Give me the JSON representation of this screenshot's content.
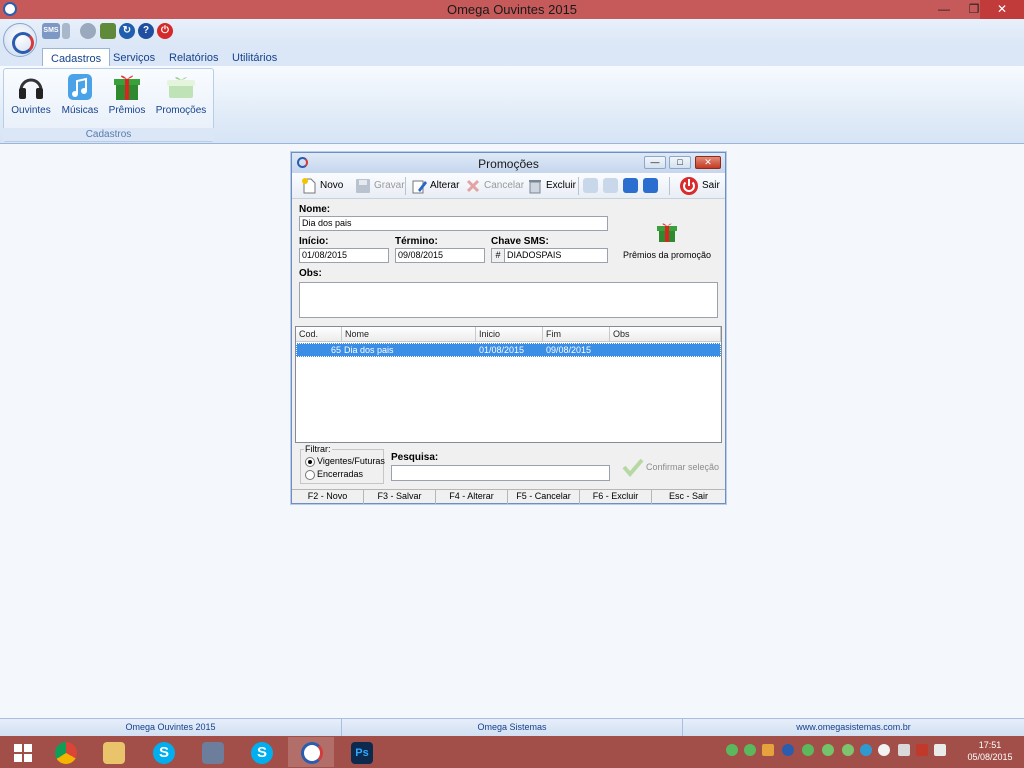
{
  "window": {
    "title": "Omega Ouvintes 2015",
    "controls": [
      "minimize-icon",
      "restore-icon",
      "close-icon"
    ]
  },
  "quick_access": {
    "items": [
      "sms-icon",
      "phone-icon",
      "globe-icon",
      "user-download-icon",
      "refresh-icon",
      "help-icon",
      "power-icon"
    ],
    "sms_label": "SMS"
  },
  "ribbon": {
    "tabs": [
      {
        "label": "Cadastros",
        "active": true
      },
      {
        "label": "Serviços"
      },
      {
        "label": "Relatórios"
      },
      {
        "label": "Utilitários"
      }
    ],
    "group_label": "Cadastros",
    "buttons": [
      {
        "label": "Ouvintes",
        "icon": "headphones-icon"
      },
      {
        "label": "Músicas",
        "icon": "music-note-icon"
      },
      {
        "label": "Prêmios",
        "icon": "gift-icon"
      },
      {
        "label": "Promoções",
        "icon": "gift-box-icon"
      }
    ]
  },
  "dialog": {
    "title": "Promoções",
    "toolbar": {
      "novo": "Novo",
      "gravar": "Gravar",
      "alterar": "Alterar",
      "cancelar": "Cancelar",
      "excluir": "Excluir",
      "sair": "Sair",
      "nav": [
        "first-record-icon",
        "previous-record-icon",
        "next-record-icon",
        "last-record-icon"
      ]
    },
    "form": {
      "nome_label": "Nome:",
      "nome_value": "Dia dos pais",
      "inicio_label": "Início:",
      "inicio_value": "01/08/2015",
      "termino_label": "Término:",
      "termino_value": "09/08/2015",
      "chave_label": "Chave SMS:",
      "chave_prefix": "#",
      "chave_value": "DIADOSPAIS",
      "obs_label": "Obs:",
      "obs_value": "",
      "premios_label": "Prêmios da promoção"
    },
    "grid": {
      "columns": [
        "Cod.",
        "Nome",
        "Inicio",
        "Fim",
        "Obs"
      ],
      "rows": [
        {
          "cod": "65",
          "nome": "Dia dos pais",
          "inicio": "01/08/2015",
          "fim": "09/08/2015",
          "obs": ""
        }
      ]
    },
    "filter": {
      "legend": "Filtrar:",
      "options": [
        {
          "label": "Vigentes/Futuras",
          "selected": true
        },
        {
          "label": "Encerradas",
          "selected": false
        }
      ]
    },
    "search": {
      "label": "Pesquisa:",
      "value": ""
    },
    "confirm_label": "Confirmar seleção",
    "fkeys": [
      "F2 - Novo",
      "F3 - Salvar",
      "F4 - Alterar",
      "F5 - Cancelar",
      "F6 - Excluir",
      "Esc - Sair"
    ]
  },
  "statusbar": [
    "Omega Ouvintes 2015",
    "Omega Sistemas",
    "www.omegasistemas.com.br"
  ],
  "taskbar": {
    "apps": [
      "windows-start-icon",
      "chrome-icon",
      "file-explorer-icon",
      "skype-icon",
      "virtualbox-icon",
      "skype-icon",
      "omega-ouvintes-icon",
      "photoshop-icon"
    ],
    "skype_glyph": "S",
    "ps_glyph": "Ps",
    "clock_time": "17:51",
    "clock_date": "05/08/2015"
  },
  "colors": {
    "ribbon_text": "#15428b",
    "selection": "#3a8ee6",
    "taskbar": "#a14f48",
    "titlebar": "#c65a5a"
  }
}
